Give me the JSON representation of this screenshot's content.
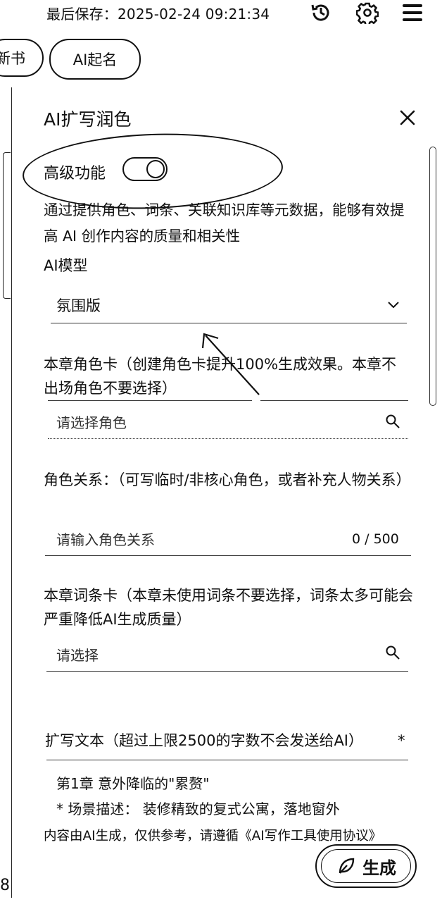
{
  "topbar": {
    "save_status": "最后保存：2025-02-24 09:21:34",
    "icons": [
      "history-icon",
      "gear-icon",
      "menu-icon"
    ]
  },
  "tabs": {
    "partial_label": "新书",
    "ai_naming_label": "AI起名"
  },
  "left_edge_text": "8",
  "panel": {
    "title": "AI扩写润色",
    "advanced": {
      "label": "高级功能",
      "enabled": true
    },
    "description": "通过提供角色、词条、关联知识库等元数据，能够有效提高 AI 创作内容的质量和相关性",
    "model": {
      "label": "AI模型",
      "selected": "氛围版"
    },
    "character_card": {
      "label": "本章角色卡（创建角色卡提升100%生成效果。本章不出场角色不要选择）",
      "placeholder": "请选择角色"
    },
    "relations": {
      "label": "角色关系：（可写临时/非核心角色，或者补充人物关系）",
      "placeholder": "请输入角色关系",
      "counter": "0 / 500"
    },
    "entry_card": {
      "label": "本章词条卡（本章未使用词条不要选择，词条太多可能会严重降低AI生成质量）",
      "placeholder": "请选择"
    },
    "expand_text": {
      "label": "扩写文本（超过上限2500的字数不会发送给AI）",
      "required_mark": "*",
      "line1": "第1章 意外降临的\"累赘\"",
      "line2": "* 场景描述： 装修精致的复式公寓，落地窗外"
    },
    "footer_note": "内容由AI生成，仅供参考，请遵循《AI写作工具使用协议》",
    "generate_label": "生成"
  }
}
